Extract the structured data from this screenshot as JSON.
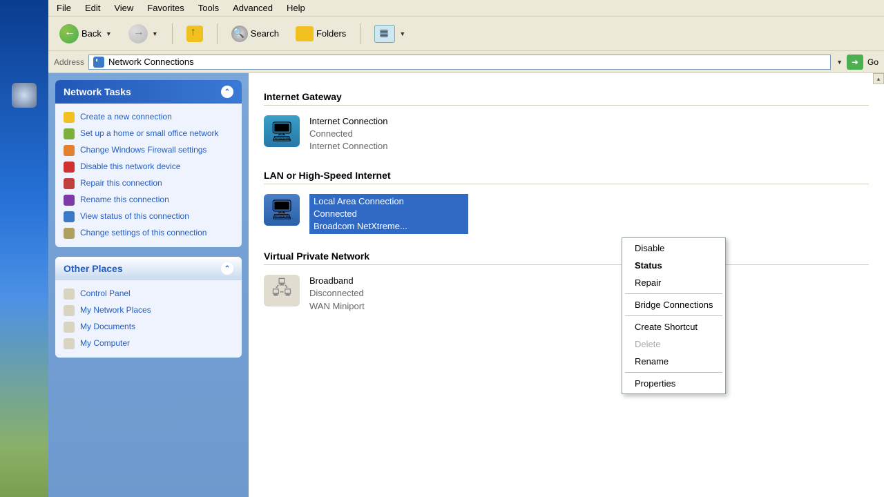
{
  "menubar": {
    "file": "File",
    "edit": "Edit",
    "view": "View",
    "favorites": "Favorites",
    "tools": "Tools",
    "advanced": "Advanced",
    "help": "Help"
  },
  "toolbar": {
    "back": "Back",
    "search": "Search",
    "folders": "Folders"
  },
  "addressbar": {
    "label": "Address",
    "value": "Network Connections",
    "go": "Go"
  },
  "sidebar": {
    "tasks_header": "Network Tasks",
    "tasks": [
      "Create a new connection",
      "Set up a home or small office network",
      "Change Windows Firewall settings",
      "Disable this network device",
      "Repair this connection",
      "Rename this connection",
      "View status of this connection",
      "Change settings of this connection"
    ],
    "places_header": "Other Places",
    "places": [
      "Control Panel",
      "My Network Places",
      "My Documents",
      "My Computer"
    ]
  },
  "groups": {
    "gateway": {
      "header": "Internet Gateway",
      "item": {
        "name": "Internet Connection",
        "status": "Connected",
        "device": "Internet Connection"
      }
    },
    "lan": {
      "header": "LAN or High-Speed Internet",
      "item": {
        "name": "Local Area Connection",
        "status": "Connected",
        "device": "Broadcom NetXtreme..."
      }
    },
    "vpn": {
      "header": "Virtual Private Network",
      "item": {
        "name": "Broadband",
        "status": "Disconnected",
        "device": "WAN Miniport"
      }
    }
  },
  "context_menu": {
    "disable": "Disable",
    "status": "Status",
    "repair": "Repair",
    "bridge": "Bridge Connections",
    "shortcut": "Create Shortcut",
    "delete": "Delete",
    "rename": "Rename",
    "properties": "Properties"
  }
}
